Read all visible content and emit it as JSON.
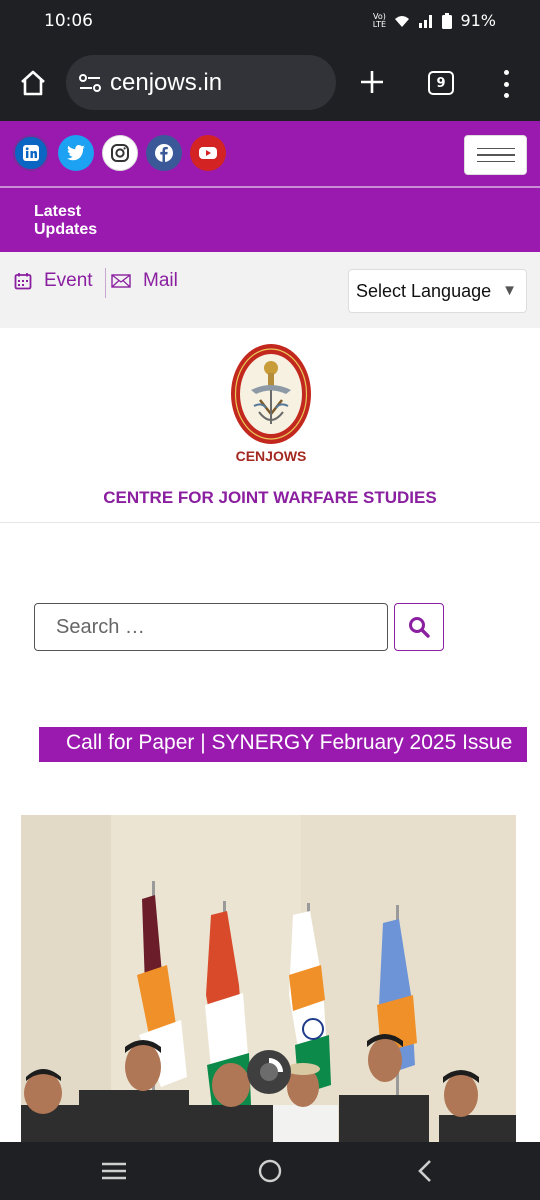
{
  "status_bar": {
    "time": "10:06",
    "network_label": "Vo) LTE",
    "battery_percent": "91%"
  },
  "browser": {
    "url": "cenjows.in",
    "tab_count": "9"
  },
  "header": {
    "social_links": [
      {
        "name": "linkedin",
        "glyph": "in",
        "color": "#0a66c2"
      },
      {
        "name": "twitter",
        "glyph": "",
        "color": "#1da1f2"
      },
      {
        "name": "instagram",
        "glyph": "",
        "color": "#ffffff"
      },
      {
        "name": "facebook",
        "glyph": "f",
        "color": "#3b5998"
      },
      {
        "name": "youtube",
        "glyph": "",
        "color": "#d32323"
      }
    ],
    "latest_updates": "Latest\nUpdates"
  },
  "toolbar": {
    "event_label": "Event",
    "mail_label": "Mail",
    "language_selected": "Select Language"
  },
  "logo": {
    "emblem_word": "CENJOWS",
    "org_name": "CENTRE FOR JOINT WARFARE STUDIES"
  },
  "search": {
    "placeholder": "Search …"
  },
  "ticker": {
    "text": "Call for Paper | SYNERGY February 2025 Issue"
  },
  "colors": {
    "brand_purple": "#9a1ab0",
    "dark_bar": "#1f2023"
  }
}
